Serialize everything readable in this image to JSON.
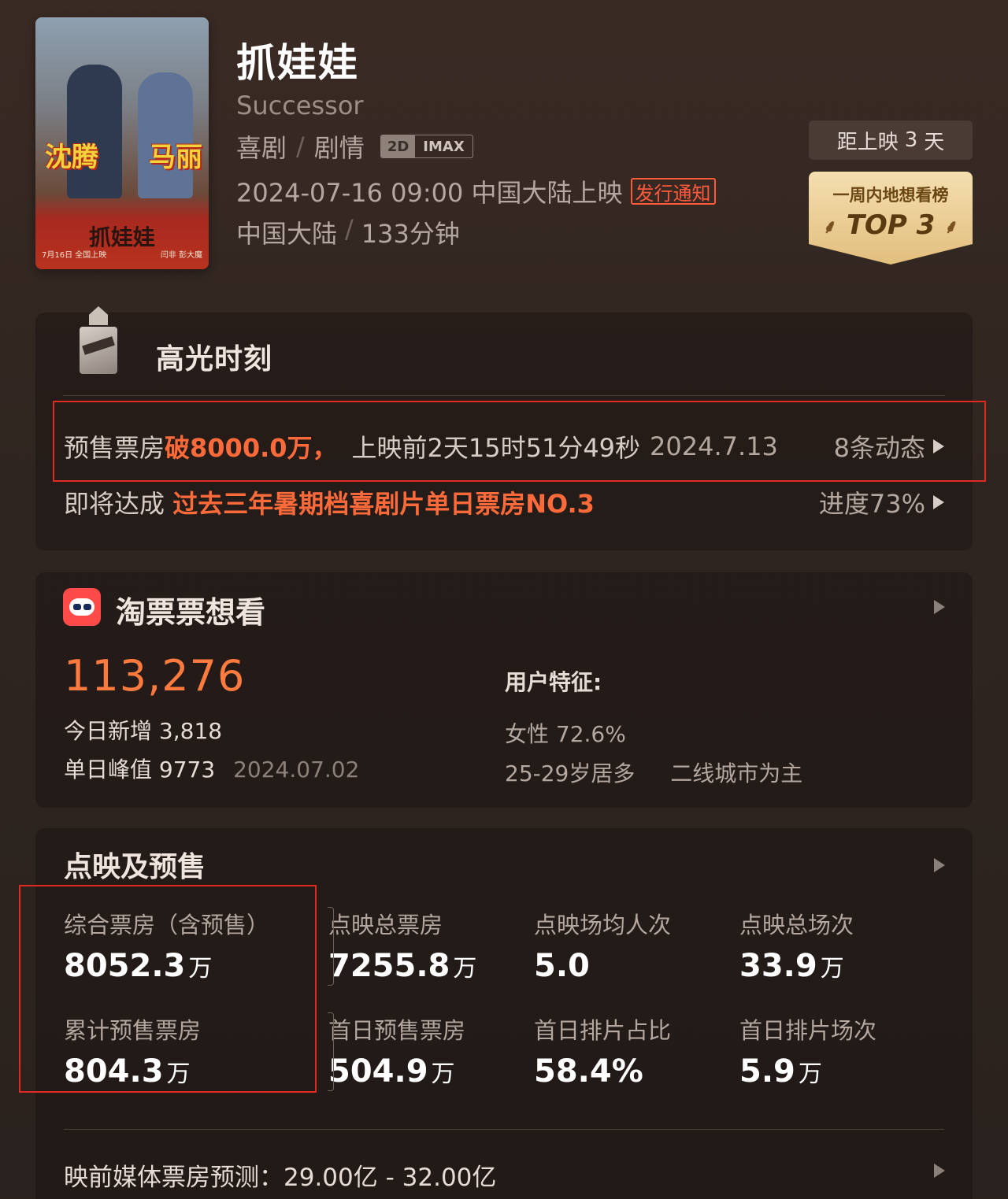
{
  "poster": {
    "names": [
      "沈腾",
      "马丽"
    ],
    "title": "抓娃娃",
    "footer_left": "7月16日 全国上映",
    "footer_right": "闫非 彭大魔"
  },
  "movie": {
    "title": "抓娃娃",
    "subtitle": "Successor",
    "genres": [
      "喜剧",
      "剧情"
    ],
    "format_2d": "2D",
    "format_imax": "IMAX",
    "release": "2024-07-16 09:00 中国大陆上映",
    "release_notice": "发行通知",
    "region": "中国大陆",
    "duration": "133分钟"
  },
  "countdown": {
    "label": "距上映",
    "days": "3",
    "unit": "天"
  },
  "top_badge": {
    "label": "一周内地想看榜",
    "rank": "TOP 3"
  },
  "highlights": {
    "title": "高光时刻",
    "row1": {
      "prefix": "预售票房",
      "accent": "破8000.0万，",
      "detail": "上映前2天15时51分49秒",
      "date": "2024.7.13",
      "right": "8条动态"
    },
    "row2": {
      "prefix": "即将达成",
      "accent": "过去三年暑期档喜剧片单日票房NO.3",
      "right": "进度73%"
    }
  },
  "want_to_see": {
    "title": "淘票票想看",
    "count": "113,276",
    "new_today_label": "今日新增",
    "new_today_value": "3,818",
    "peak_label": "单日峰值",
    "peak_value": "9773",
    "peak_date": "2024.07.02",
    "features_title": "用户特征:",
    "feature_gender": "女性 72.6%",
    "feature_age": "25-29岁居多",
    "feature_city": "二线城市为主"
  },
  "presale": {
    "title": "点映及预售",
    "stats": [
      {
        "label": "综合票房（含预售）",
        "value": "8052.3",
        "unit": "万"
      },
      {
        "label": "点映总票房",
        "value": "7255.8",
        "unit": "万"
      },
      {
        "label": "点映场均人次",
        "value": "5.0",
        "unit": ""
      },
      {
        "label": "点映总场次",
        "value": "33.9",
        "unit": "万"
      },
      {
        "label": "累计预售票房",
        "value": "804.3",
        "unit": "万"
      },
      {
        "label": "首日预售票房",
        "value": "504.9",
        "unit": "万"
      },
      {
        "label": "首日排片占比",
        "value": "58.4%",
        "unit": ""
      },
      {
        "label": "首日排片场次",
        "value": "5.9",
        "unit": "万"
      }
    ],
    "forecast": "映前媒体票房预测：29.00亿 - 32.00亿"
  },
  "colors": {
    "accent": "#ff6a3a",
    "annotation_box": "#e02a22",
    "badge_gold": "#e2bf7e"
  }
}
